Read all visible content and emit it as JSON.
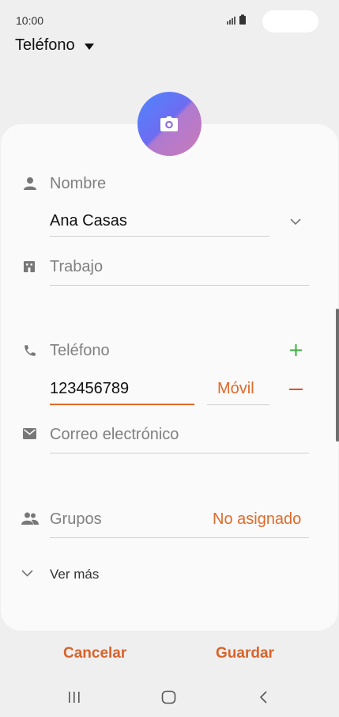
{
  "status": {
    "time": "10:00"
  },
  "header": {
    "account_label": "Teléfono"
  },
  "form": {
    "name": {
      "label": "Nombre",
      "value": "Ana Casas"
    },
    "work": {
      "label": "Trabajo"
    },
    "phone": {
      "label": "Teléfono",
      "value": "123456789",
      "type": "Móvil"
    },
    "email": {
      "label": "Correo electrónico"
    },
    "groups": {
      "label": "Grupos",
      "value": "No asignado"
    },
    "more": {
      "label": "Ver más"
    }
  },
  "actions": {
    "cancel": "Cancelar",
    "save": "Guardar"
  },
  "colors": {
    "accent": "#e06a2a",
    "add": "#3cae3c",
    "remove": "#e0522a"
  }
}
